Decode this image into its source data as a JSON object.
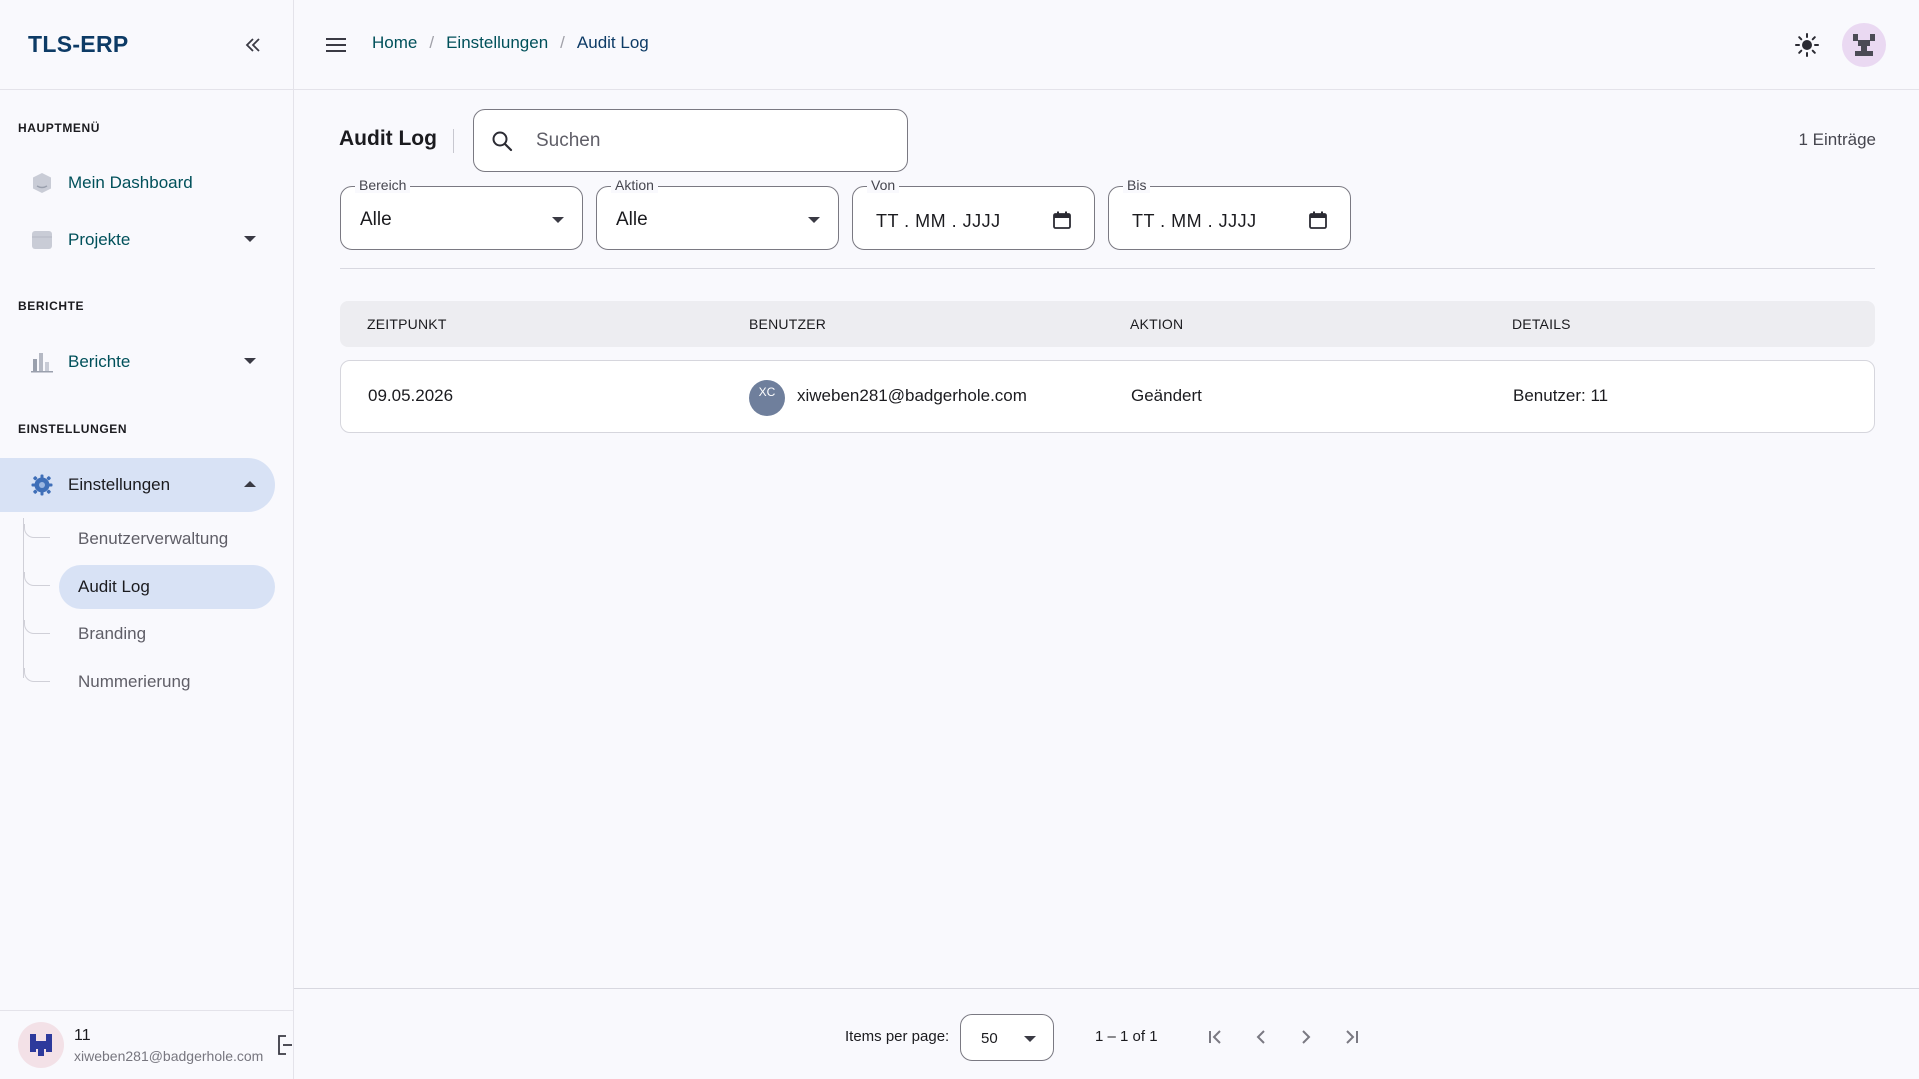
{
  "app": {
    "brand": "TLS-ERP"
  },
  "sidebar": {
    "sections": {
      "main": "HAUPTMENÜ",
      "reports": "BERICHTE",
      "settings": "EINSTELLUNGEN"
    },
    "items": [
      {
        "label": "Mein Dashboard",
        "icon": "dashboard-icon"
      },
      {
        "label": "Projekte",
        "icon": "folder-icon"
      },
      {
        "label": "Berichte",
        "icon": "bar-chart-icon"
      },
      {
        "label": "Einstellungen",
        "icon": "gear-icon",
        "active": true
      }
    ],
    "sub_items": [
      {
        "label": "Benutzerverwaltung"
      },
      {
        "label": "Audit Log",
        "active": true
      },
      {
        "label": "Branding"
      },
      {
        "label": "Nummerierung"
      }
    ],
    "user": {
      "name": "11",
      "email": "xiweben281@badgerhole.com"
    }
  },
  "breadcrumb": [
    "Home",
    "Einstellungen",
    "Audit Log"
  ],
  "page": {
    "title": "Audit Log",
    "search_placeholder": "Suchen",
    "entries": "1 Einträge"
  },
  "filters": {
    "bereich": {
      "label": "Bereich",
      "value": "Alle"
    },
    "aktion": {
      "label": "Aktion",
      "value": "Alle"
    },
    "von": {
      "label": "Von",
      "placeholder": "TT . MM . JJJJ"
    },
    "bis": {
      "label": "Bis",
      "placeholder": "TT . MM . JJJJ"
    }
  },
  "table": {
    "columns": [
      "ZEITPUNKT",
      "BENUTZER",
      "AKTION",
      "DETAILS"
    ],
    "rows": [
      {
        "zeitpunkt": "09.05.2026",
        "avatar": "XC",
        "benutzer": "xiweben281@badgerhole.com",
        "aktion": "Geändert",
        "details": "Benutzer: 11"
      }
    ]
  },
  "paginator": {
    "items_per_page_label": "Items per page:",
    "items_per_page": "50",
    "range": "1 – 1 of 1"
  },
  "colors": {
    "brand": "#0d3b66",
    "link": "#00505a",
    "active_bg": "#d8e2f5",
    "avatar_row": "#6f7f9c"
  }
}
